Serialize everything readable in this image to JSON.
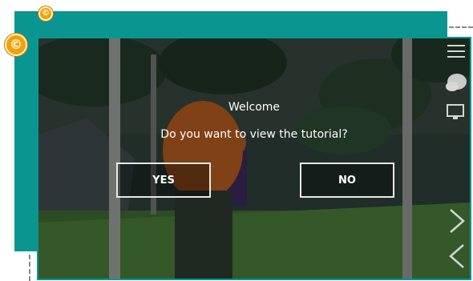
{
  "dialog": {
    "title": "Welcome",
    "question": "Do you want to view the tutorial?",
    "yes_label": "YES",
    "no_label": "NO"
  },
  "badges": {
    "coin_small_symbol": "©",
    "coin_large_symbol": "©"
  },
  "icons": [
    "coin-icon",
    "menu-icon",
    "cloud-icon",
    "monitor-icon",
    "chevron-right-icon",
    "chevron-left-icon"
  ],
  "colors": {
    "teal": "#0b9591",
    "coin": "#f2a10c",
    "button_border": "#e8e8e8",
    "text": "#ffffff"
  }
}
